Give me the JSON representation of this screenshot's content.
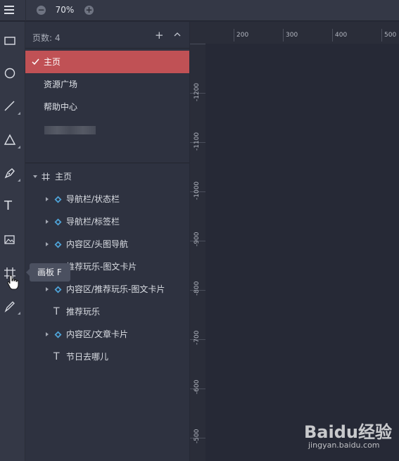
{
  "topbar": {
    "zoom_level": "70%",
    "zoom_minus": "−",
    "zoom_plus": "+"
  },
  "toolbar": {
    "tools": [
      "rectangle-icon",
      "ellipse-icon",
      "line-icon",
      "triangle-icon",
      "pen-icon",
      "text-icon",
      "image-icon",
      "artboard-icon",
      "pencil-icon"
    ],
    "text_tool_glyph": "T",
    "tooltip": "画板 F"
  },
  "pages": {
    "label": "页数:",
    "count": "4",
    "add": "+",
    "items": [
      {
        "label": "主页",
        "active": true
      },
      {
        "label": "资源广场",
        "active": false
      },
      {
        "label": "帮助中心",
        "active": false
      }
    ]
  },
  "layers": {
    "root": "主页",
    "items": [
      {
        "label": "导航栏/状态栏",
        "type": "symbol"
      },
      {
        "label": "导航栏/标签栏",
        "type": "symbol"
      },
      {
        "label": "内容区/头图导航",
        "type": "symbol"
      },
      {
        "label": "推荐玩乐-图文卡片",
        "type": "text"
      },
      {
        "label": "内容区/推荐玩乐-图文卡片",
        "type": "symbol"
      },
      {
        "label": "推荐玩乐",
        "type": "text"
      },
      {
        "label": "内容区/文章卡片",
        "type": "symbol"
      },
      {
        "label": "节日去哪儿",
        "type": "text"
      }
    ],
    "text_glyph": "T"
  },
  "ruler": {
    "horizontal": [
      "200",
      "300",
      "400",
      "500"
    ],
    "vertical": [
      "-1200",
      "-1100",
      "-1000",
      "-900",
      "-800",
      "-700",
      "-600",
      "-500"
    ]
  },
  "watermark": {
    "brand": "Baidu经验",
    "url": "jingyan.baidu.com"
  },
  "colors": {
    "accent": "#c05155",
    "symbol": "#4ea3d8",
    "canvas": "#262936"
  }
}
